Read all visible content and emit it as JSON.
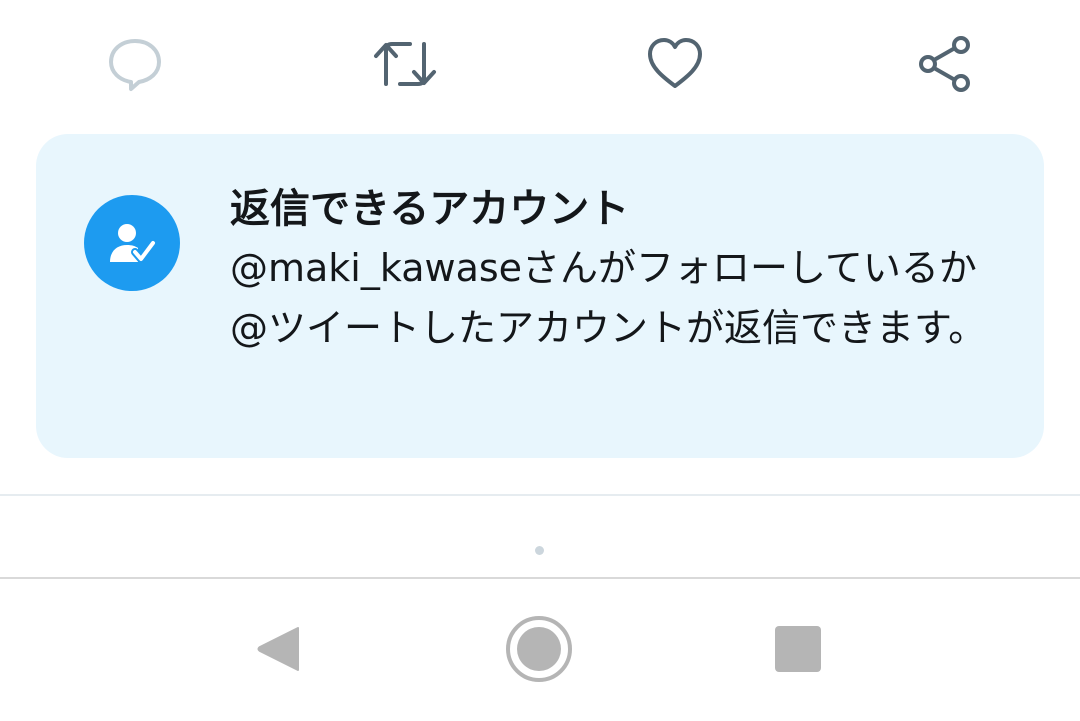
{
  "actions": {
    "reply_icon": "speech-bubble",
    "retweet_icon": "retweet-arrows",
    "like_icon": "heart",
    "share_icon": "share-nodes"
  },
  "reply_restriction": {
    "icon": "person-check",
    "title": "返信できるアカウント",
    "description": "@maki_kawaseさんがフォローしているか@ツイートしたアカウントが返信できます。"
  },
  "navigation": {
    "back_icon": "triangle-back",
    "home_icon": "circle-home",
    "recents_icon": "square-recents"
  },
  "colors": {
    "accent": "#1d9bf0",
    "card_background": "#e8f6fd",
    "icon_gray": "#536471",
    "icon_disabled": "#c4cfd6",
    "nav_gray": "#b5b5b5",
    "text": "#14171a"
  }
}
